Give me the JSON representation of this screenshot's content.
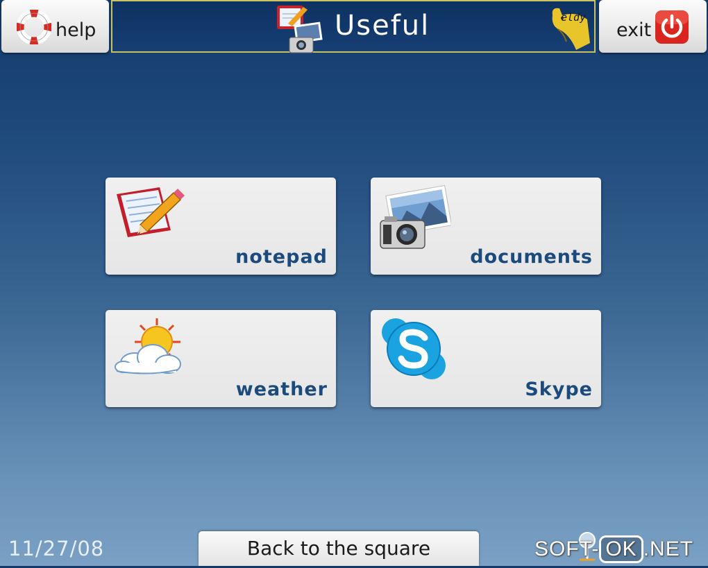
{
  "header": {
    "help_label": "help",
    "exit_label": "exit",
    "title": "Useful",
    "brand_logo_text": "eldy"
  },
  "tiles": [
    {
      "label": "notepad",
      "icon": "notepad-icon"
    },
    {
      "label": "documents",
      "icon": "camera-photo-icon"
    },
    {
      "label": "weather",
      "icon": "sun-cloud-icon"
    },
    {
      "label": "Skype",
      "icon": "skype-icon"
    }
  ],
  "footer": {
    "date": "11/27/08",
    "back_label": "Back to the square",
    "watermark_left": "SOFT-",
    "watermark_box": "OK",
    "watermark_right": ".NET"
  },
  "colors": {
    "tile_label": "#1b4b7c",
    "title_border": "#c9c260",
    "exit_red": "#d9251d"
  }
}
